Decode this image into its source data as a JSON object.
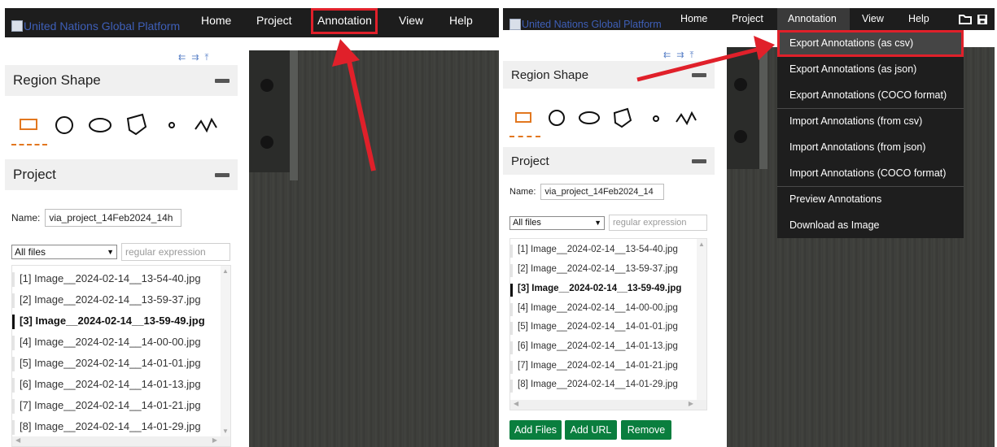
{
  "app": {
    "brand": "United Nations Global Platform",
    "nav": [
      "Home",
      "Project",
      "Annotation",
      "View",
      "Help"
    ]
  },
  "sidebar": {
    "region_shape_title": "Region Shape",
    "shapes": [
      "rectangle-icon",
      "circle-icon",
      "ellipse-icon",
      "polygon-icon",
      "point-icon",
      "polyline-icon"
    ],
    "project_title": "Project",
    "name_label": "Name:",
    "left_name_value": "via_project_14Feb2024_14h",
    "right_name_value": "via_project_14Feb2024_14",
    "filter_value": "All files",
    "filter_placeholder": "regular expression",
    "files": [
      "[1] Image__2024-02-14__13-54-40.jpg",
      "[2] Image__2024-02-14__13-59-37.jpg",
      "[3] Image__2024-02-14__13-59-49.jpg",
      "[4] Image__2024-02-14__14-00-00.jpg",
      "[5] Image__2024-02-14__14-01-01.jpg",
      "[6] Image__2024-02-14__14-01-13.jpg",
      "[7] Image__2024-02-14__14-01-21.jpg",
      "[8] Image__2024-02-14__14-01-29.jpg"
    ],
    "active_file_index": 2,
    "buttons": [
      "Add Files",
      "Add URL",
      "Remove"
    ]
  },
  "annotation_menu": {
    "items": [
      "Export Annotations (as csv)",
      "Export Annotations (as json)",
      "Export Annotations (COCO format)",
      "Import Annotations (from csv)",
      "Import Annotations (from json)",
      "Import Annotations (COCO format)",
      "Preview Annotations",
      "Download as Image"
    ],
    "highlighted_index": 0
  },
  "toolbar_icons": [
    "folder-icon",
    "save-icon"
  ],
  "colors": {
    "topbar": "#1d1d1d",
    "brand": "#3e5fb8",
    "highlight_red": "#e0202a",
    "active_shape": "#e2771f",
    "button_green": "#0a7e3e"
  }
}
